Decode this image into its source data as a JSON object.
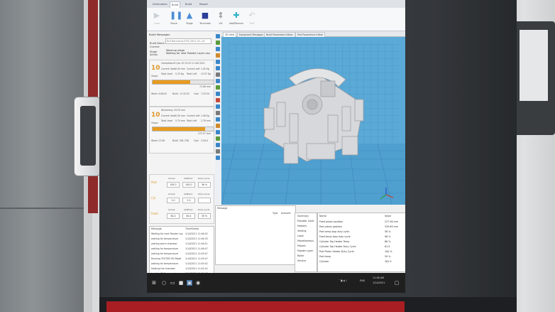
{
  "ribbon": {
    "tabs": [
      "Information",
      "Build",
      "Build",
      "Report"
    ],
    "tools": [
      {
        "label": "Load",
        "icon": "play-icon",
        "color": "#9aa3ad",
        "disabled": true
      },
      {
        "label": "Pause",
        "icon": "pause-icon",
        "color": "#4a8ed6",
        "disabled": false
      },
      {
        "label": "Stage",
        "icon": "stage-icon",
        "color": "#4a8ed6",
        "disabled": false
      },
      {
        "label": "Terminate",
        "icon": "stop-icon",
        "color": "#2b3e99",
        "disabled": false
      },
      {
        "label": "Lift",
        "icon": "lift-icon",
        "color": "#7a7a7a",
        "disabled": false
      },
      {
        "label": "Add/Remove",
        "icon": "plus-icon",
        "color": "#2fb3c6",
        "disabled": false
      },
      {
        "label": "Exit",
        "icon": "undo-icon",
        "color": "#a0a0a0",
        "disabled": true
      }
    ]
  },
  "left_panel": {
    "header": "Build Messages",
    "build_name_label": "Build Name",
    "build_name_value": "IN-TitaniumA-STD-2021-01-14",
    "current_stage_label": "Current Stage",
    "current_stage_value": "Warmup stage",
    "action_label": "Action",
    "action_value": "Waiting for next Powder Layer capable",
    "stage1": {
      "number": "10",
      "sub": "Stage",
      "completion_label": "Completion",
      "completion": "Fri Jan 15 01:47:11 AM 2021",
      "current_label": "Current Used",
      "current": "0.00 mm",
      "left_label": "Current Left",
      "left": "1.00 Kg",
      "total_label": "Total Used",
      "total": "5.70 Kg",
      "total_left_label": "Total Left",
      "total_left": "15.57 Kg",
      "progress": 0.62,
      "pct": "72.68 mm",
      "warm_label": "Warm",
      "warm": "3:08:42",
      "build_label": "Build",
      "build": "11:32:52",
      "cool_label": "Cool",
      "cool": "7:22:54"
    },
    "stage2": {
      "number": "10",
      "sub": "Stage",
      "remaining_label": "Remaining",
      "remaining": "20:20 mm",
      "current_label": "Current Used",
      "current": "0.00 mm",
      "left_label": "Current Left",
      "left": "1.08 Kg",
      "total_label": "Total Used",
      "total": "5.70 mm",
      "total_left_label": "Total Left",
      "total_left": "2.78 mm",
      "progress": 0.86,
      "pct": "272.97 mm",
      "warm_label": "Warm",
      "warm": "12:08",
      "build_label": "Build",
      "build": "281:738",
      "cool_label": "Cool",
      "cool": "2:54:0"
    },
    "heaters": [
      {
        "name": "Part",
        "actual_h": "Actual",
        "set_h": "SetPoint",
        "duty_h": "Duty Cycle",
        "actual": "162.0",
        "set": "162.0",
        "duty": "56 %"
      },
      {
        "name": "Cyl",
        "actual_h": "Actual",
        "set_h": "SetPoint",
        "duty_h": "Duty Cycle",
        "actual": "2.0",
        "set": "2.0",
        "duty": ""
      },
      {
        "name": "Feed",
        "actual_h": "Actual",
        "set_h": "SetPoint",
        "duty_h": "Duty Cycle",
        "actual": "82.4",
        "set": "82.4",
        "duty": "30 %"
      }
    ],
    "messages": {
      "header_msg": "Message",
      "header_time": "TimeStamp",
      "rows": [
        {
          "msg": "Waiting for next Powder Lay",
          "time": "1/14/2021 11:46:42"
        },
        {
          "msg": "waiting for temperature",
          "time": "1/14/2021 11:46:33"
        },
        {
          "msg": "waiting warm chamber",
          "time": "1/14/2021 11:46:21"
        },
        {
          "msg": "waiting for temperature",
          "time": "1/14/2021 11:46:47"
        },
        {
          "msg": "waiting for temperature",
          "time": "1/14/2021 11:45:47"
        },
        {
          "msg": "Running SYSTEM ON Mode",
          "time": "1/14/2021 11:45:47"
        },
        {
          "msg": "waiting for temperature",
          "time": "1/14/2021 11:45:42"
        },
        {
          "msg": "Heating the chamber",
          "time": "1/14/2021 11:45:42"
        },
        {
          "msg": "Loading PLC parameters",
          "time": "1/14/2021 11:45:42"
        }
      ]
    }
  },
  "view_tabs": [
    "3D View",
    "Equipment Messages",
    "Build Parameters Editor",
    "Part Parameters Editor"
  ],
  "bottom": {
    "message_header": "Message",
    "type_header": "Type",
    "activate_header": "Activate",
    "list_header": "Summary",
    "list_items": [
      "Elevator Contr",
      "Heaters",
      "Venting",
      "Laser",
      "Miscellaneous",
      "Pistons",
      "Powder Layer",
      "Roller",
      "Service"
    ],
    "prop_name_header": "Name",
    "prop_value_header": "Value",
    "props": [
      {
        "name": "Feed piston position",
        "value": "227.98 mm"
      },
      {
        "name": "Part piston position",
        "value": "539.89 mm"
      },
      {
        "name": "Part temp loop duty cycle",
        "value": "56 %"
      },
      {
        "name": "Feed temp loop duty cycle",
        "value": "96 %"
      },
      {
        "name": "Cylinder Top Heater Temp",
        "value": "86 %"
      },
      {
        "name": "Cylinder Top Heater Duty Cycle",
        "value": "61.9"
      },
      {
        "name": "Part Piston Heater Duty Cycle",
        "value": "100 %"
      },
      {
        "name": "Part temp",
        "value": "59 %"
      },
      {
        "name": "Cylinder",
        "value": "161.9"
      }
    ]
  },
  "taskbar": {
    "lang": "ENG",
    "time": "11:46 AM",
    "date": "1/14/2021"
  },
  "colors": {
    "accent_orange": "#e79b1f",
    "viewport_blue": "#5aa9d6",
    "taskbar": "#1f1f1f"
  }
}
